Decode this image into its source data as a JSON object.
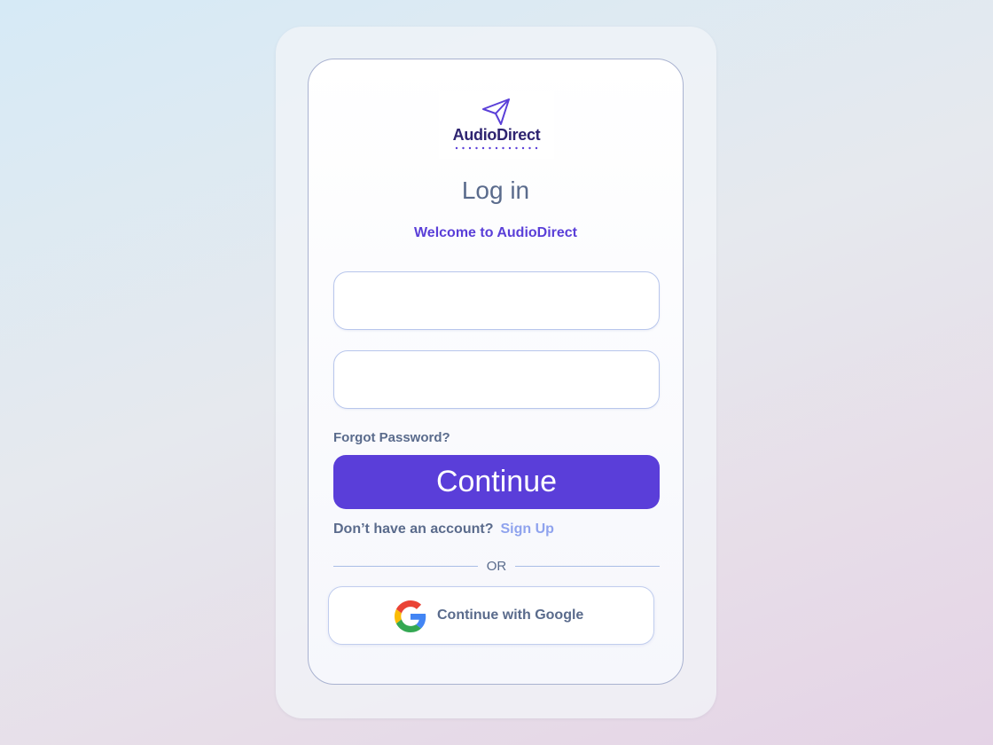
{
  "logo": {
    "brand": "AudioDirect",
    "icon": "paper-plane-icon",
    "color": "#2e2470",
    "icon_color": "#5a3fd8"
  },
  "form": {
    "title": "Log in",
    "welcome": "Welcome to AudioDirect",
    "username_value": "",
    "password_value": "",
    "forgot_password": "Forgot Password?",
    "continue_label": "Continue",
    "no_account": "Don’t have an account?",
    "sign_up": "Sign Up",
    "divider": "OR",
    "google_label": "Continue with Google",
    "google_icon": "google-icon"
  },
  "colors": {
    "accent": "#5a3ed9",
    "link": "#8fa3ee",
    "text": "#5a6b8c"
  }
}
